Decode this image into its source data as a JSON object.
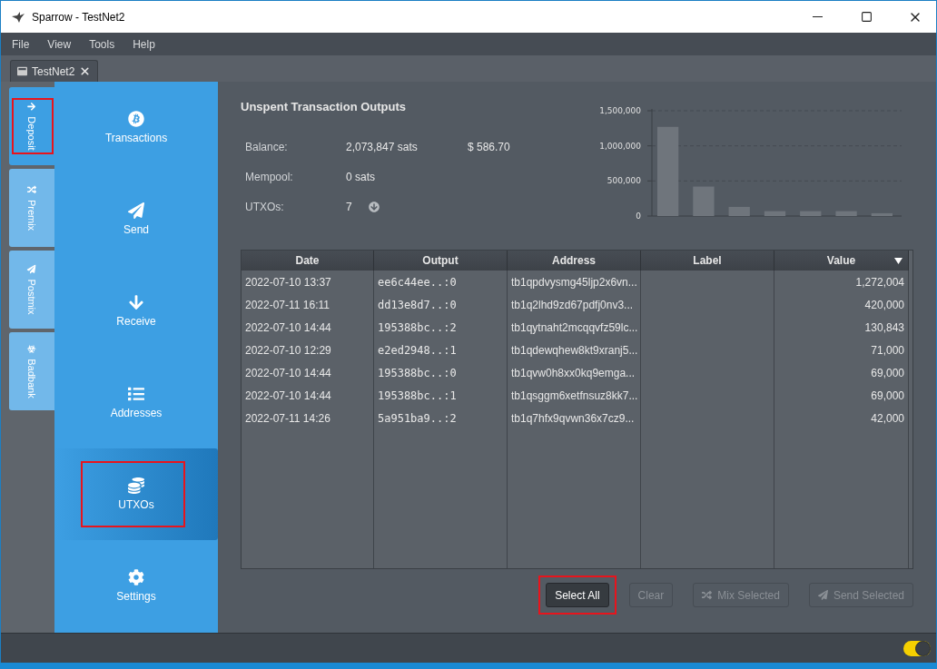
{
  "window": {
    "title": "Sparrow - TestNet2"
  },
  "menu": [
    "File",
    "View",
    "Tools",
    "Help"
  ],
  "document_tabs": [
    {
      "label": "TestNet2",
      "selected": true
    }
  ],
  "account_tabs": [
    {
      "label": "Deposit",
      "kind": "deposit",
      "selected": true,
      "highlighted": true
    },
    {
      "label": "Premix",
      "kind": "premix",
      "selected": false,
      "highlighted": false
    },
    {
      "label": "Postmix",
      "kind": "postmix",
      "selected": false,
      "highlighted": false
    },
    {
      "label": "Badbank",
      "kind": "badbank",
      "selected": false,
      "highlighted": false
    }
  ],
  "nav": [
    {
      "label": "Transactions",
      "kind": "transactions",
      "selected": false,
      "highlighted": false
    },
    {
      "label": "Send",
      "kind": "send",
      "selected": false,
      "highlighted": false
    },
    {
      "label": "Receive",
      "kind": "receive",
      "selected": false,
      "highlighted": false
    },
    {
      "label": "Addresses",
      "kind": "addresses",
      "selected": false,
      "highlighted": false
    },
    {
      "label": "UTXOs",
      "kind": "utxos",
      "selected": true,
      "highlighted": true
    },
    {
      "label": "Settings",
      "kind": "settings",
      "selected": false,
      "highlighted": false
    }
  ],
  "utxos": {
    "title": "Unspent Transaction Outputs",
    "summary": [
      {
        "label": "Balance:",
        "value": "2,073,847 sats",
        "fiat": "$ 586.70"
      },
      {
        "label": "Mempool:",
        "value": "0 sats"
      },
      {
        "label": "UTXOs:",
        "value": "7",
        "expand_icon": true
      }
    ],
    "chart_data": {
      "type": "bar",
      "values": [
        1270000,
        420000,
        130000,
        70000,
        70000,
        70000,
        40000
      ],
      "ylim": [
        0,
        1500000
      ],
      "yticks": [
        {
          "value": 0,
          "label": "0"
        },
        {
          "value": 500000,
          "label": "500,000"
        },
        {
          "value": 1000000,
          "label": "1,000,000"
        },
        {
          "value": 1500000,
          "label": "1,500,000"
        }
      ]
    },
    "table": {
      "columns": [
        {
          "label": "Date",
          "sorted": false
        },
        {
          "label": "Output",
          "sorted": false
        },
        {
          "label": "Address",
          "sorted": false
        },
        {
          "label": "Label",
          "sorted": false
        },
        {
          "label": "Value",
          "sorted": true
        }
      ],
      "rows": [
        [
          "2022-07-10 13:37",
          "ee6c44ee..:0",
          "tb1qpdvysmg45ljp2x6vn...",
          "",
          "1,272,004"
        ],
        [
          "2022-07-11 16:11",
          "dd13e8d7..:0",
          "tb1q2lhd9zd67pdfj0nv3...",
          "",
          "420,000"
        ],
        [
          "2022-07-10 14:44",
          "195388bc..:2",
          "tb1qytnaht2mcqqvfz59lc...",
          "",
          "130,843"
        ],
        [
          "2022-07-10 12:29",
          "e2ed2948..:1",
          "tb1qdewqhew8kt9xranj5...",
          "",
          "71,000"
        ],
        [
          "2022-07-10 14:44",
          "195388bc..:0",
          "tb1qvw0h8xx0kq9emga...",
          "",
          "69,000"
        ],
        [
          "2022-07-10 14:44",
          "195388bc..:1",
          "tb1qsggm6xetfnsuz8kk7...",
          "",
          "69,000"
        ],
        [
          "2022-07-11 14:26",
          "5a951ba9..:2",
          "tb1q7hfx9qvwn36x7cz9...",
          "",
          "42,000"
        ]
      ]
    },
    "buttons": [
      {
        "label": "Select All",
        "kind": "plain",
        "disabled": false,
        "highlighted": true
      },
      {
        "label": "Clear",
        "kind": "plain",
        "disabled": true,
        "highlighted": false
      },
      {
        "label": "Mix Selected",
        "kind": "mix",
        "disabled": true,
        "highlighted": false
      },
      {
        "label": "Send Selected",
        "kind": "send",
        "disabled": true,
        "highlighted": false
      }
    ]
  },
  "status_bar": {
    "toggle_on": true
  }
}
